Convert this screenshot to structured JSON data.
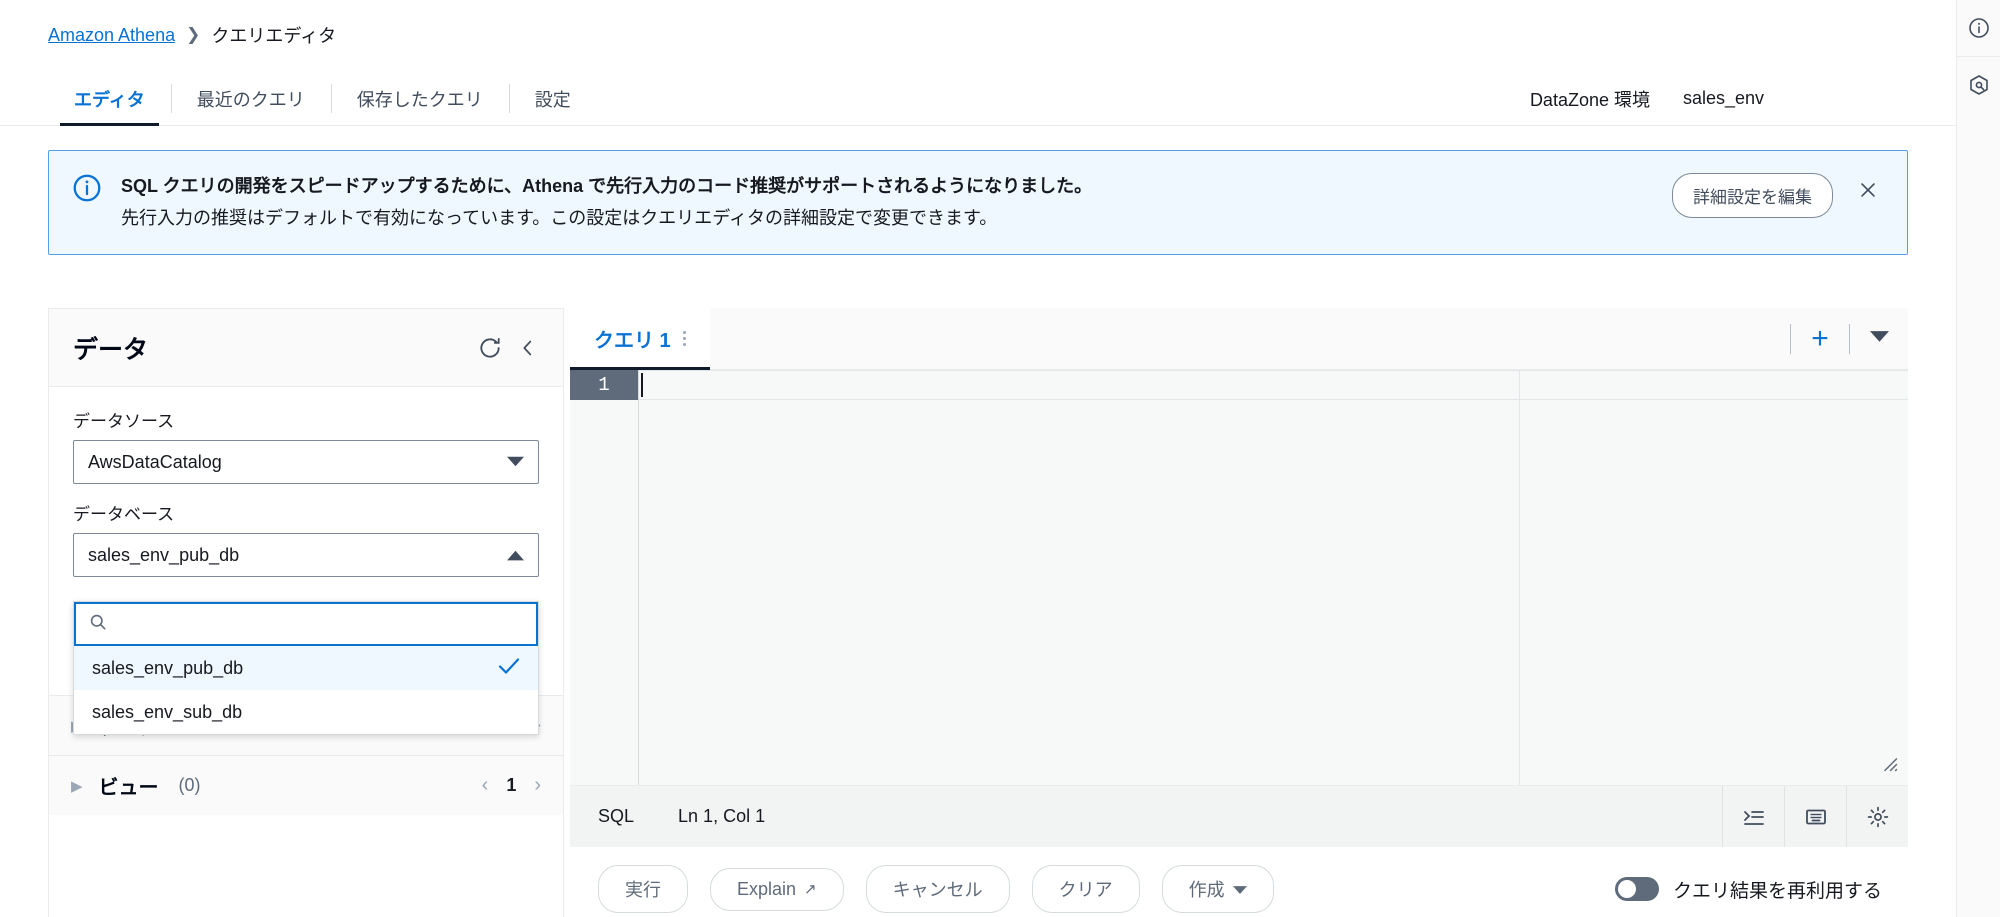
{
  "breadcrumb": {
    "root": "Amazon Athena",
    "separator": "❯",
    "current": "クエリエディタ"
  },
  "tabs": [
    {
      "label": "エディタ",
      "active": true
    },
    {
      "label": "最近のクエリ",
      "active": false
    },
    {
      "label": "保存したクエリ",
      "active": false
    },
    {
      "label": "設定",
      "active": false
    }
  ],
  "datazone": {
    "label": "DataZone 環境",
    "value": "sales_env"
  },
  "alert": {
    "icon": "info-icon",
    "title": "SQL クエリの開発をスピードアップするために、Athena で先行入力のコード推奨がサポートされるようになりました。",
    "description": "先行入力の推奨はデフォルトで有効になっています。この設定はクエリエディタの詳細設定で変更できます。",
    "action_label": "詳細設定を編集",
    "close_label": "✕",
    "accent_color": "#539fe5",
    "background_color": "#f0f8ff"
  },
  "data_panel": {
    "title": "データ",
    "refresh_icon": "refresh-icon",
    "collapse_icon": "chevron-left-icon",
    "datasource": {
      "label": "データソース",
      "value": "AwsDataCatalog"
    },
    "database": {
      "label": "データベース",
      "value": "sales_env_pub_db",
      "expanded": true,
      "search_placeholder": "",
      "search_value": "",
      "options": [
        {
          "label": "sales_env_pub_db",
          "selected": true
        },
        {
          "label": "sales_env_sub_db",
          "selected": false
        }
      ]
    },
    "sections": [
      {
        "label": "テーブル",
        "count": "(0)",
        "page": "1"
      },
      {
        "label": "ビュー",
        "count": "(0)",
        "page": "1"
      }
    ]
  },
  "editor": {
    "query_tab": "クエリ 1",
    "kebab_icon": "kebab-menu-icon",
    "add_tab_icon": "plus-icon",
    "more_tabs_icon": "chevron-down-icon",
    "line_numbers": [
      "1"
    ],
    "code": "",
    "status": {
      "language": "SQL",
      "cursor": "Ln 1, Col 1",
      "buttons": [
        {
          "name": "format-icon"
        },
        {
          "name": "keyboard-icon"
        },
        {
          "name": "gear-icon"
        }
      ]
    },
    "actions": [
      {
        "label": "実行",
        "external": false,
        "caret": false
      },
      {
        "label": "Explain",
        "external": true,
        "caret": false
      },
      {
        "label": "キャンセル",
        "external": false,
        "caret": false
      },
      {
        "label": "クリア",
        "external": false,
        "caret": false
      },
      {
        "label": "作成",
        "external": false,
        "caret": true
      }
    ],
    "reuse_toggle": {
      "label": "クエリ結果を再利用する",
      "enabled": false
    }
  },
  "right_rail": [
    {
      "name": "info-circle-icon"
    },
    {
      "name": "settings-hex-icon"
    }
  ],
  "colors": {
    "link": "#0972d3",
    "text": "#16191f",
    "muted": "#5f6b7a",
    "border": "#e9ebed",
    "panel_bg": "#fafafa"
  }
}
